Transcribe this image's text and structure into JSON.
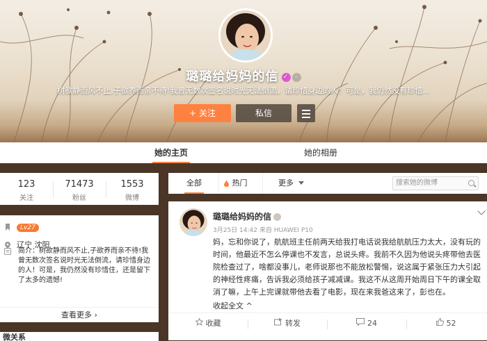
{
  "cover": {
    "nickname": "璐璐给妈妈的信",
    "intro": "树欲静而风不止,子欲养而亲不待!我曾无数次签名说时光无法倒流，请珍惜身边的人！可是，我仍然没有珍惜..."
  },
  "actions": {
    "follow": "关注",
    "message": "私信",
    "follow_icon": "+"
  },
  "tabs": {
    "home": "她的主页",
    "album": "她的相册"
  },
  "stats": [
    {
      "num": "123",
      "label": "关注"
    },
    {
      "num": "71473",
      "label": "粉丝"
    },
    {
      "num": "1553",
      "label": "微博"
    }
  ],
  "info": {
    "level": "Lv27",
    "location": "辽宁 沈阳",
    "bio": "简介：树欲静而风不止,子欲养而亲不待!我曾无数次签名说时光无法倒流，请珍惜身边的人！可是，我仍然没有珍惜住，还是留下了太多的遗憾!",
    "see_more": "查看更多 ›",
    "bottom_label": "微关系"
  },
  "feed_filter": {
    "all": "全部",
    "hot": "热门",
    "more": "更多",
    "search_placeholder": "搜索她的微博"
  },
  "post": {
    "name": "璐璐给妈妈的信",
    "meta": "3月25日 14:42 来自 HUAWEI P10",
    "text": "妈，忘和你说了，航航班主任前两天给我打电话说我给航航压力太大，没有玩的时间，他最近不怎么停课也不发言，总说头疼。我前不久因为他说头疼带他去医院检查过了，啥都没事儿，老师说那也不能放松警惕，说这属于紧张压力大引起的神经性疼痛，告诉我必须给孩子减减课。我这不从这周开始周日下午的课全取消了嘛，上午上完课就带他去看了电影，现在来我爸这来了，彭也在。",
    "fold": "收起全文 ^",
    "favorite": "收藏",
    "repost": "转发",
    "comments": "24",
    "likes": "52"
  },
  "colors": {
    "accent": "#ff8140",
    "level_badge": "#fb7a2f",
    "verified_badge": "#e15bd1"
  }
}
